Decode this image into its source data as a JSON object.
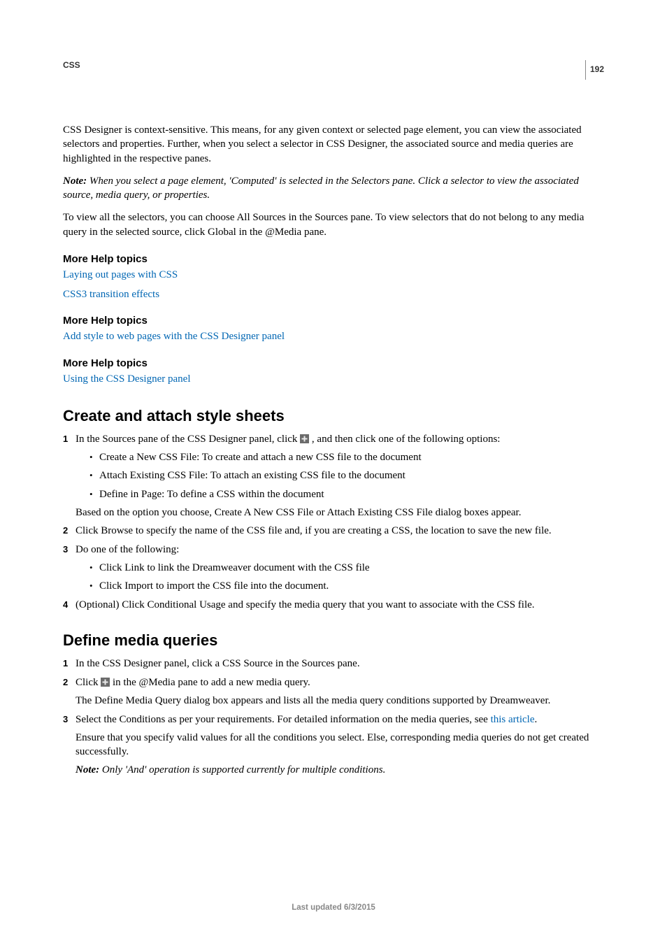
{
  "meta": {
    "section_label": "CSS",
    "page_number": "192",
    "footer": "Last updated 6/3/2015"
  },
  "intro": {
    "p1": "CSS Designer is context-sensitive. This means, for any given context or selected page element, you can view the associated selectors and properties. Further, when you select a selector in CSS Designer, the associated source and media queries are highlighted in the respective panes.",
    "note_label": "Note:",
    "note_body": " When you select a page element, 'Computed' is selected in the Selectors pane. Click a selector to view the associated source, media query, or properties.",
    "p2": "To view all the selectors, you can choose All Sources in the Sources pane. To view selectors that do not belong to any media query in the selected source, click Global in the @Media pane."
  },
  "help1": {
    "heading": "More Help topics",
    "link1": "Laying out pages with CSS",
    "link2": "CSS3 transition effects"
  },
  "help2": {
    "heading": "More Help topics",
    "link1": "Add style to web pages with the CSS Designer panel"
  },
  "help3": {
    "heading": "More Help topics",
    "link1": "Using the CSS Designer panel"
  },
  "create": {
    "heading": "Create and attach style sheets",
    "step1_a": "In the Sources pane of the CSS Designer panel, click ",
    "step1_b": " , and then click one of the following options:",
    "bullet1": "Create a New CSS File: To create and attach a new CSS file to the document",
    "bullet2": "Attach Existing CSS File: To attach an existing CSS file to the document",
    "bullet3": "Define in Page: To define a CSS within the document",
    "step1_after": "Based on the option you choose, Create A New CSS File or Attach Existing CSS File dialog boxes appear.",
    "step2": "Click Browse to specify the name of the CSS file and, if you are creating a CSS, the location to save the new file.",
    "step3": "Do one of the following:",
    "step3_b1": "Click Link to link the Dreamweaver document with the CSS file",
    "step3_b2": "Click Import to import the CSS file into the document.",
    "step4": "(Optional) Click Conditional Usage and specify the media query that you want to associate with the CSS file."
  },
  "media": {
    "heading": "Define media queries",
    "step1": "In the CSS Designer panel, click a CSS Source in the Sources pane.",
    "step2_a": "Click ",
    "step2_b": " in the @Media pane to add a new media query.",
    "step2_after": "The Define Media Query dialog box appears and lists all the media query conditions supported by Dreamweaver.",
    "step3_a": "Select the Conditions as per your requirements. For detailed information on the media queries, see ",
    "step3_link": "this article",
    "step3_b": ".",
    "step3_after": "Ensure that you specify valid values for all the conditions you select. Else, corresponding media queries do not get created successfully.",
    "note_label": "Note:",
    "note_body": " Only 'And' operation is supported currently for multiple conditions."
  }
}
